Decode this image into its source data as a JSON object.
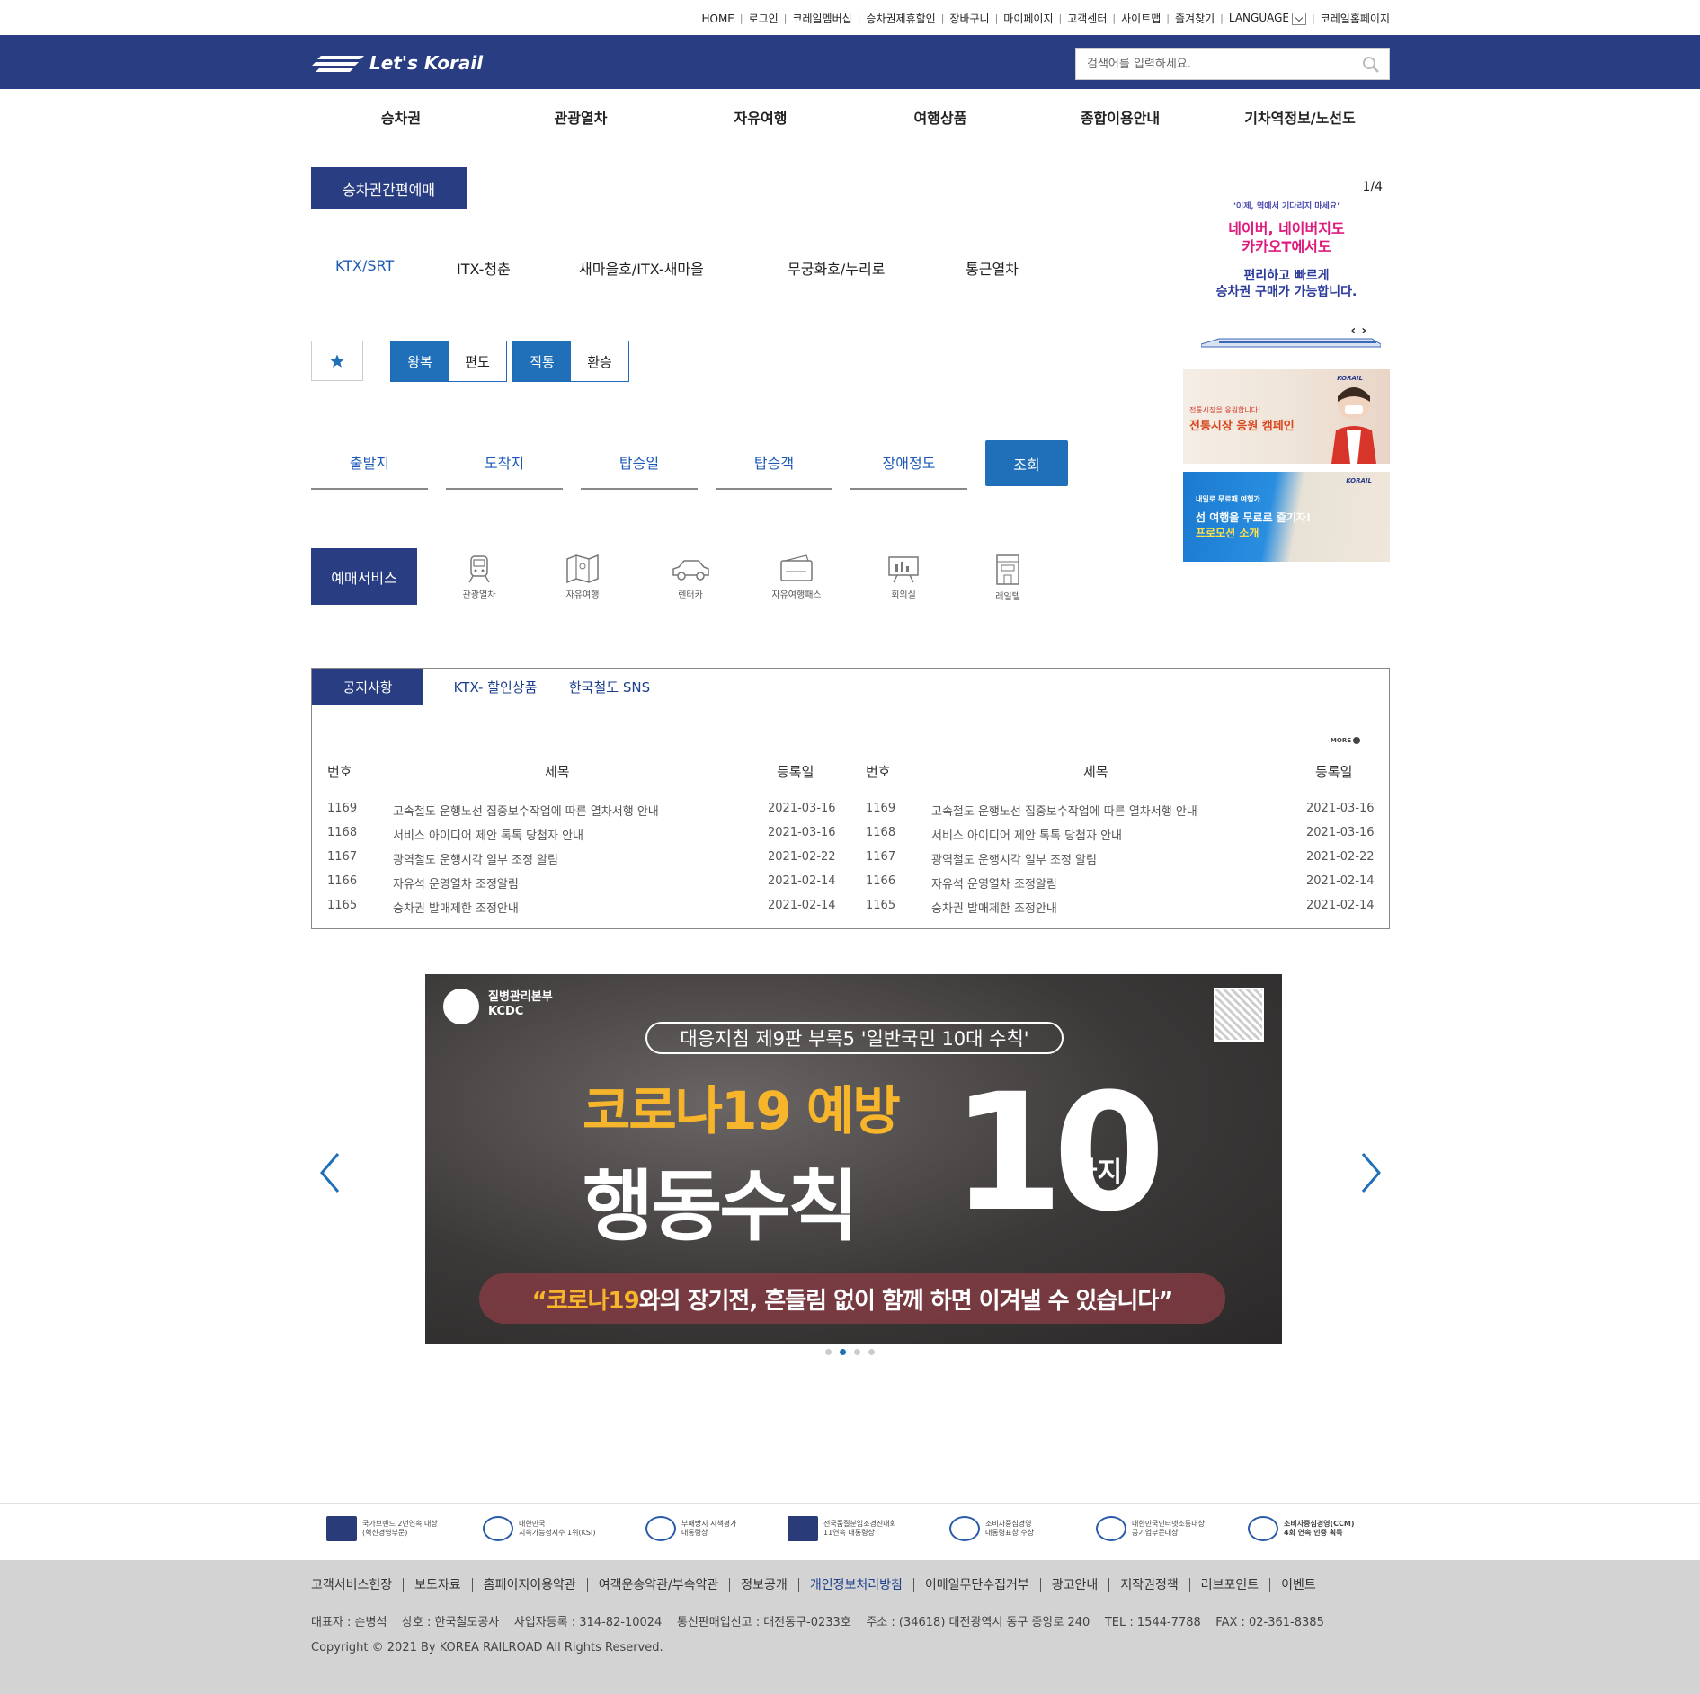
{
  "utility_links": [
    "HOME",
    "로그인",
    "코레일멤버십",
    "승차권제휴할인",
    "장바구니",
    "마이페이지",
    "고객센터",
    "사이트맵",
    "즐겨찾기",
    "LANGUAGE",
    "코레일홈페이지"
  ],
  "header": {
    "logo_text": "Let's Korail",
    "search_placeholder": "검색어를 입력하세요.",
    "brand_color": "#293e82"
  },
  "gnb": [
    "승차권",
    "관광열차",
    "자유여행",
    "여행상품",
    "종합이용안내",
    "기차역정보/노선도"
  ],
  "quick_booking": {
    "title": "승차권간편예매",
    "train_tabs": [
      {
        "label": "KTX/SRT",
        "active": true
      },
      {
        "label": "ITX-청춘",
        "active": false
      },
      {
        "label": "새마을호/ITX-새마을",
        "active": false
      },
      {
        "label": "무궁화호/누리로",
        "active": false
      },
      {
        "label": "통근열차",
        "active": false
      }
    ],
    "trip_type": {
      "round": "왕복",
      "oneway": "편도",
      "selected": "왕복"
    },
    "route_type": {
      "direct": "직통",
      "transfer": "환승",
      "selected": "직통"
    },
    "fields": [
      "출발지",
      "도착지",
      "탑승일",
      "탑승객",
      "장애정도"
    ],
    "query_button": "조회",
    "accent_color": "#1f6fb9"
  },
  "services": {
    "title": "예매서비스",
    "items": [
      {
        "label": "관광열차",
        "icon": "train-icon"
      },
      {
        "label": "자유여행",
        "icon": "map-icon"
      },
      {
        "label": "렌터카",
        "icon": "car-icon"
      },
      {
        "label": "자유여행패스",
        "icon": "pass-icon"
      },
      {
        "label": "회의실",
        "icon": "meeting-room-icon"
      },
      {
        "label": "레일텔",
        "icon": "hotel-icon"
      }
    ]
  },
  "side_ads": {
    "ad1": {
      "page": "1/4",
      "line1": "\"이제, 역에서 기다리지 마세요\"",
      "line2": "네이버, 네이버지도\n카카오T에서도",
      "line3": "편리하고 빠르게\n승차권 구매가 가능합니다."
    },
    "ad2": {
      "small": "전통시장을 응원합니다!",
      "title": "전통시장 응원 캠페인"
    },
    "ad3": {
      "small": "내일로 무료패 여행가",
      "title_a": "섬 여행을 무료로 즐기자!",
      "title_b": "프로모션 소개"
    }
  },
  "board": {
    "tabs": [
      "공지사항",
      "KTX- 할인상품",
      "한국철도 SNS"
    ],
    "active_tab": "공지사항",
    "more": "MORE",
    "headers": [
      "번호",
      "제목",
      "등록일"
    ],
    "rows": [
      {
        "no": "1169",
        "title": "고속철도 운행노선 집중보수작업에 따른 열차서행 안내",
        "date": "2021-03-16"
      },
      {
        "no": "1168",
        "title": "서비스 아이디어 제안 톡톡 당첨자 안내",
        "date": "2021-03-16"
      },
      {
        "no": "1167",
        "title": "광역철도 운행시각 일부 조정 알림",
        "date": "2021-02-22"
      },
      {
        "no": "1166",
        "title": "자유석 운영열차 조정알림",
        "date": "2021-02-14"
      },
      {
        "no": "1165",
        "title": "승차권 발매제한 조정안내",
        "date": "2021-02-14"
      }
    ]
  },
  "banner": {
    "org": "질병관리본부\nKCDC",
    "pill": "대응지침 제9판 부록5 '일반국민 10대 수칙'",
    "yellow": "코로나19 예방",
    "white": "행동수칙",
    "big": "10",
    "gaji": "가지",
    "quote_a": "“코로나19",
    "quote_b": "와의 장기전, 흔들림 없이 함께 하면 이겨낼 수 있습니다”",
    "slide_count": 4,
    "active_slide": 2
  },
  "awards": [
    {
      "text": "국가브랜드 2년연속 대상\n(혁신경영부문)"
    },
    {
      "text": "대한민국\n지속가능성지수 1위(KSI)"
    },
    {
      "text": "부패방지 시책평가\n대통령상"
    },
    {
      "text": "전국품질분임조경진대회\n11연속 대통령상"
    },
    {
      "text": "소비자중심경영\n대통령표창 수상"
    },
    {
      "text": "대한민국인터넷소통대상\n공기업부문대상"
    },
    {
      "text": "소비자중심경영(CCM)\n4회 연속 인증 획득"
    }
  ],
  "footer": {
    "links": [
      "고객서비스헌장",
      "보도자료",
      "홈페이지이용약관",
      "여객운송약관/부속약관",
      "정보공개",
      "개인정보처리방침",
      "이메일무단수집거부",
      "광고안내",
      "저작권정책",
      "러브포인트",
      "이벤트"
    ],
    "highlight": "개인정보처리방침",
    "info": "대표자 : 손병석    상호 : 한국철도공사    사업자등록 : 314-82-10024    통신판매업신고 : 대전동구-0233호    주소 : (34618) 대전광역시 동구 중앙로 240    TEL : 1544-7788    FAX : 02-361-8385",
    "copyright": "Copyright © 2021 By KOREA RAILROAD All Rights Reserved."
  }
}
